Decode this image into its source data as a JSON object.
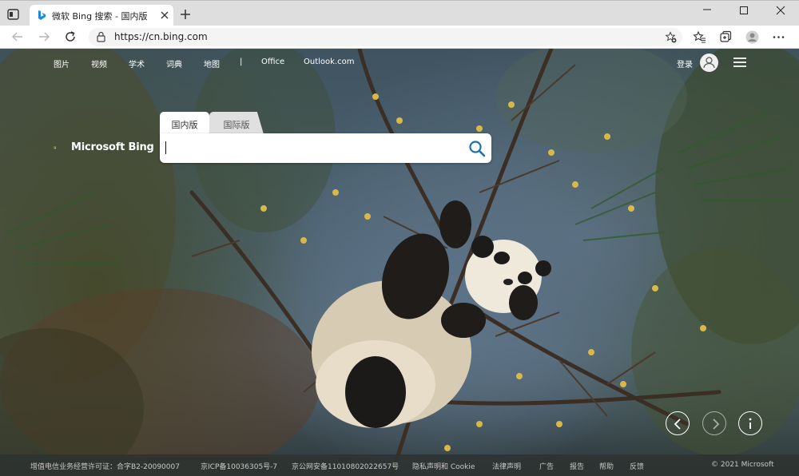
{
  "browser": {
    "tab_title": "微软 Bing 搜索 - 国内版",
    "url": "https://cn.bing.com",
    "icons": {
      "tab_actions": "tab-actions-icon",
      "favicon": "bing-favicon-icon",
      "close_tab": "close-icon",
      "new_tab": "plus-icon",
      "back": "arrow-left-icon",
      "forward": "arrow-right-icon",
      "refresh": "refresh-icon",
      "lock": "lock-icon",
      "add_favorite": "star-plus-icon",
      "favorites": "favorites-icon",
      "collections": "collections-icon",
      "profile": "profile-icon",
      "more": "more-dots-icon"
    }
  },
  "topnav": {
    "items": [
      "图片",
      "视频",
      "学术",
      "词典",
      "地图",
      "|",
      "Office",
      "Outlook.com"
    ],
    "signin": "登录"
  },
  "search": {
    "logo_text": "Microsoft Bing",
    "tabs": [
      "国内版",
      "国际版"
    ],
    "query": "",
    "placeholder": ""
  },
  "footer": {
    "items": [
      "增值电信业务经营许可证：合字B2-20090007",
      "京ICP备10036305号-7",
      "京公网安备11010802022657号",
      "隐私声明和 Cookie",
      "法律声明",
      "广告",
      "报告",
      "帮助",
      "反馈",
      "© 2021 Microsoft"
    ]
  },
  "colors": {
    "accent": "#1a73a8",
    "tabstrip": "#dedede",
    "footer": "#2d3230"
  }
}
